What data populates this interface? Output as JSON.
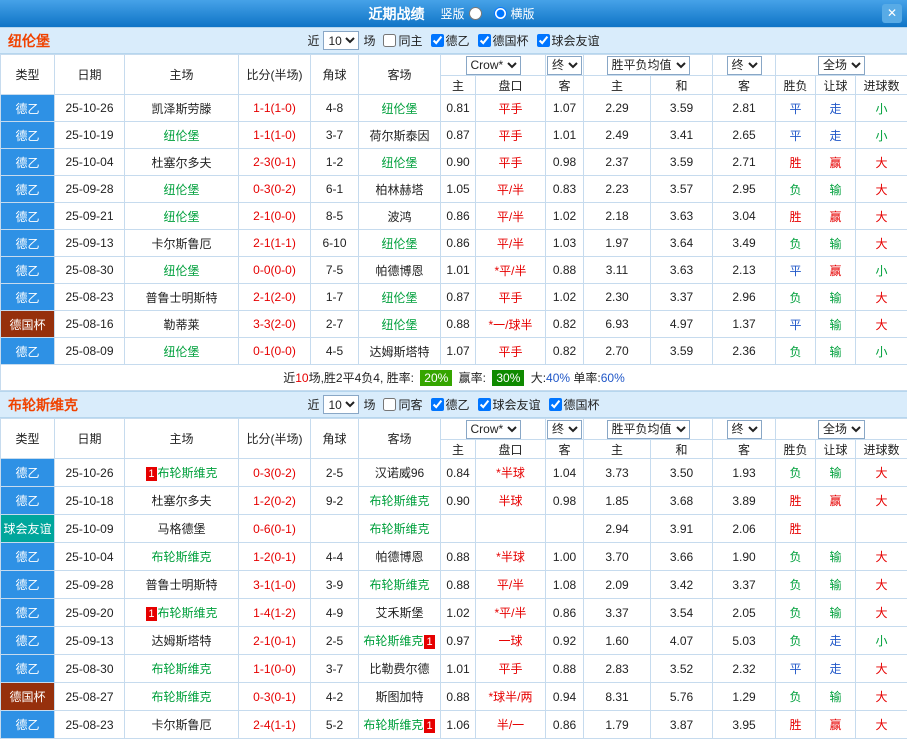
{
  "titlebar": {
    "title": "近期战绩",
    "layout_options": [
      {
        "label": "竖版",
        "selected": false
      },
      {
        "label": "横版",
        "selected": true
      }
    ],
    "close_label": "✕"
  },
  "table_header": {
    "type": "类型",
    "date": "日期",
    "home": "主场",
    "score": "比分(半场)",
    "corner": "角球",
    "away": "客场",
    "odds_company": "Crow*",
    "final1": "终",
    "avg_label": "胜平负均值",
    "final2": "终",
    "scope": "全场",
    "sub": [
      "主",
      "盘口",
      "客",
      "主",
      "和",
      "客",
      "胜负",
      "让球",
      "进球数"
    ]
  },
  "sections": [
    {
      "team": "纽伦堡",
      "filter": {
        "near": "近",
        "count": "10",
        "unit": "场",
        "checkboxes": [
          {
            "label": "同主",
            "checked": false
          },
          {
            "label": "德乙",
            "checked": true
          },
          {
            "label": "德国杯",
            "checked": true
          },
          {
            "label": "球会友谊",
            "checked": true
          }
        ]
      },
      "rows": [
        {
          "league": "德乙",
          "lc": "blue",
          "date": "25-10-26",
          "home": {
            "n": "凯泽斯劳滕",
            "f": false
          },
          "score": "1-1(1-0)",
          "corner": "4-8",
          "away": {
            "n": "纽伦堡",
            "f": true
          },
          "odds": [
            "0.81",
            "平手",
            "1.07"
          ],
          "avg": [
            "2.29",
            "3.59",
            "2.81"
          ],
          "results": [
            [
              "平",
              "b"
            ],
            [
              "走",
              "b"
            ],
            [
              "小",
              "g"
            ]
          ]
        },
        {
          "league": "德乙",
          "lc": "blue",
          "date": "25-10-19",
          "home": {
            "n": "纽伦堡",
            "f": true
          },
          "score": "1-1(1-0)",
          "corner": "3-7",
          "away": {
            "n": "荷尔斯泰因",
            "f": false
          },
          "odds": [
            "0.87",
            "平手",
            "1.01"
          ],
          "avg": [
            "2.49",
            "3.41",
            "2.65"
          ],
          "results": [
            [
              "平",
              "b"
            ],
            [
              "走",
              "b"
            ],
            [
              "小",
              "g"
            ]
          ]
        },
        {
          "league": "德乙",
          "lc": "blue",
          "date": "25-10-04",
          "home": {
            "n": "杜塞尔多夫",
            "f": false
          },
          "score": "2-3(0-1)",
          "corner": "1-2",
          "away": {
            "n": "纽伦堡",
            "f": true
          },
          "odds": [
            "0.90",
            "平手",
            "0.98"
          ],
          "avg": [
            "2.37",
            "3.59",
            "2.71"
          ],
          "results": [
            [
              "胜",
              "r"
            ],
            [
              "赢",
              "r"
            ],
            [
              "大",
              "r"
            ]
          ]
        },
        {
          "league": "德乙",
          "lc": "blue",
          "date": "25-09-28",
          "home": {
            "n": "纽伦堡",
            "f": true
          },
          "score": "0-3(0-2)",
          "corner": "6-1",
          "away": {
            "n": "柏林赫塔",
            "f": false
          },
          "odds": [
            "1.05",
            "平/半",
            "0.83"
          ],
          "avg": [
            "2.23",
            "3.57",
            "2.95"
          ],
          "results": [
            [
              "负",
              "g"
            ],
            [
              "输",
              "g"
            ],
            [
              "大",
              "r"
            ]
          ]
        },
        {
          "league": "德乙",
          "lc": "blue",
          "date": "25-09-21",
          "home": {
            "n": "纽伦堡",
            "f": true
          },
          "score": "2-1(0-0)",
          "corner": "8-5",
          "away": {
            "n": "波鸿",
            "f": false
          },
          "odds": [
            "0.86",
            "平/半",
            "1.02"
          ],
          "avg": [
            "2.18",
            "3.63",
            "3.04"
          ],
          "results": [
            [
              "胜",
              "r"
            ],
            [
              "赢",
              "r"
            ],
            [
              "大",
              "r"
            ]
          ]
        },
        {
          "league": "德乙",
          "lc": "blue",
          "date": "25-09-13",
          "home": {
            "n": "卡尔斯鲁厄",
            "f": false
          },
          "score": "2-1(1-1)",
          "corner": "6-10",
          "away": {
            "n": "纽伦堡",
            "f": true
          },
          "odds": [
            "0.86",
            "平/半",
            "1.03"
          ],
          "avg": [
            "1.97",
            "3.64",
            "3.49"
          ],
          "results": [
            [
              "负",
              "g"
            ],
            [
              "输",
              "g"
            ],
            [
              "大",
              "r"
            ]
          ]
        },
        {
          "league": "德乙",
          "lc": "blue",
          "date": "25-08-30",
          "home": {
            "n": "纽伦堡",
            "f": true
          },
          "score": "0-0(0-0)",
          "corner": "7-5",
          "away": {
            "n": "帕德博恩",
            "f": false
          },
          "odds": [
            "1.01",
            "*平/半",
            "0.88"
          ],
          "avg": [
            "3.11",
            "3.63",
            "2.13"
          ],
          "results": [
            [
              "平",
              "b"
            ],
            [
              "赢",
              "r"
            ],
            [
              "小",
              "g"
            ]
          ]
        },
        {
          "league": "德乙",
          "lc": "blue",
          "date": "25-08-23",
          "home": {
            "n": "普鲁士明斯特",
            "f": false
          },
          "score": "2-1(2-0)",
          "corner": "1-7",
          "away": {
            "n": "纽伦堡",
            "f": true
          },
          "odds": [
            "0.87",
            "平手",
            "1.02"
          ],
          "avg": [
            "2.30",
            "3.37",
            "2.96"
          ],
          "results": [
            [
              "负",
              "g"
            ],
            [
              "输",
              "g"
            ],
            [
              "大",
              "r"
            ]
          ]
        },
        {
          "league": "德国杯",
          "lc": "maroon",
          "date": "25-08-16",
          "home": {
            "n": "勒蒂莱",
            "f": false
          },
          "score": "3-3(2-0)",
          "corner": "2-7",
          "away": {
            "n": "纽伦堡",
            "f": true
          },
          "odds": [
            "0.88",
            "*一/球半",
            "0.82"
          ],
          "avg": [
            "6.93",
            "4.97",
            "1.37"
          ],
          "results": [
            [
              "平",
              "b"
            ],
            [
              "输",
              "g"
            ],
            [
              "大",
              "r"
            ]
          ]
        },
        {
          "league": "德乙",
          "lc": "blue",
          "date": "25-08-09",
          "home": {
            "n": "纽伦堡",
            "f": true
          },
          "score": "0-1(0-0)",
          "corner": "4-5",
          "away": {
            "n": "达姆斯塔特",
            "f": false
          },
          "odds": [
            "1.07",
            "平手",
            "0.82"
          ],
          "avg": [
            "2.70",
            "3.59",
            "2.36"
          ],
          "results": [
            [
              "负",
              "g"
            ],
            [
              "输",
              "g"
            ],
            [
              "小",
              "g"
            ]
          ]
        }
      ],
      "summary": [
        {
          "t": "近",
          "c": "k"
        },
        {
          "t": "10",
          "c": "r"
        },
        {
          "t": "场,胜2平4负4, 胜率: ",
          "c": "k"
        },
        {
          "t": "20%",
          "c": "g1"
        },
        {
          "t": " 赢率: ",
          "c": "k"
        },
        {
          "t": "30%",
          "c": "g2"
        },
        {
          "t": " 大:",
          "c": "k"
        },
        {
          "t": "40%",
          "c": "b"
        },
        {
          "t": " 单率:",
          "c": "k"
        },
        {
          "t": "60%",
          "c": "b"
        }
      ]
    },
    {
      "team": "布轮斯维克",
      "filter": {
        "near": "近",
        "count": "10",
        "unit": "场",
        "checkboxes": [
          {
            "label": "同客",
            "checked": false
          },
          {
            "label": "德乙",
            "checked": true
          },
          {
            "label": "球会友谊",
            "checked": true
          },
          {
            "label": "德国杯",
            "checked": true
          }
        ]
      },
      "rows": [
        {
          "league": "德乙",
          "lc": "blue",
          "date": "25-10-26",
          "home": {
            "n": "布轮斯维克",
            "f": true,
            "pre": true
          },
          "score": "0-3(0-2)",
          "corner": "2-5",
          "away": {
            "n": "汉诺威96",
            "f": false
          },
          "odds": [
            "0.84",
            "*半球",
            "1.04"
          ],
          "avg": [
            "3.73",
            "3.50",
            "1.93"
          ],
          "results": [
            [
              "负",
              "g"
            ],
            [
              "输",
              "g"
            ],
            [
              "大",
              "r"
            ]
          ]
        },
        {
          "league": "德乙",
          "lc": "blue",
          "date": "25-10-18",
          "home": {
            "n": "杜塞尔多夫",
            "f": false
          },
          "score": "1-2(0-2)",
          "corner": "9-2",
          "away": {
            "n": "布轮斯维克",
            "f": true
          },
          "odds": [
            "0.90",
            "半球",
            "0.98"
          ],
          "avg": [
            "1.85",
            "3.68",
            "3.89"
          ],
          "results": [
            [
              "胜",
              "r"
            ],
            [
              "赢",
              "r"
            ],
            [
              "大",
              "r"
            ]
          ]
        },
        {
          "league": "球会友谊",
          "lc": "teal",
          "date": "25-10-09",
          "home": {
            "n": "马格德堡",
            "f": false
          },
          "score": "0-6(0-1)",
          "corner": "",
          "away": {
            "n": "布轮斯维克",
            "f": true
          },
          "odds": [
            "",
            "",
            ""
          ],
          "avg": [
            "2.94",
            "3.91",
            "2.06"
          ],
          "results": [
            [
              "胜",
              "r"
            ],
            [
              "",
              ""
            ],
            [
              "",
              ""
            ]
          ]
        },
        {
          "league": "德乙",
          "lc": "blue",
          "date": "25-10-04",
          "home": {
            "n": "布轮斯维克",
            "f": true
          },
          "score": "1-2(0-1)",
          "corner": "4-4",
          "away": {
            "n": "帕德博恩",
            "f": false
          },
          "odds": [
            "0.88",
            "*半球",
            "1.00"
          ],
          "avg": [
            "3.70",
            "3.66",
            "1.90"
          ],
          "results": [
            [
              "负",
              "g"
            ],
            [
              "输",
              "g"
            ],
            [
              "大",
              "r"
            ]
          ]
        },
        {
          "league": "德乙",
          "lc": "blue",
          "date": "25-09-28",
          "home": {
            "n": "普鲁士明斯特",
            "f": false
          },
          "score": "3-1(1-0)",
          "corner": "3-9",
          "away": {
            "n": "布轮斯维克",
            "f": true
          },
          "odds": [
            "0.88",
            "平/半",
            "1.08"
          ],
          "avg": [
            "2.09",
            "3.42",
            "3.37"
          ],
          "results": [
            [
              "负",
              "g"
            ],
            [
              "输",
              "g"
            ],
            [
              "大",
              "r"
            ]
          ]
        },
        {
          "league": "德乙",
          "lc": "blue",
          "date": "25-09-20",
          "home": {
            "n": "布轮斯维克",
            "f": true,
            "pre": true
          },
          "score": "1-4(1-2)",
          "corner": "4-9",
          "away": {
            "n": "艾禾斯堡",
            "f": false
          },
          "odds": [
            "1.02",
            "*平/半",
            "0.86"
          ],
          "avg": [
            "3.37",
            "3.54",
            "2.05"
          ],
          "results": [
            [
              "负",
              "g"
            ],
            [
              "输",
              "g"
            ],
            [
              "大",
              "r"
            ]
          ]
        },
        {
          "league": "德乙",
          "lc": "blue",
          "date": "25-09-13",
          "home": {
            "n": "达姆斯塔特",
            "f": false
          },
          "score": "2-1(0-1)",
          "corner": "2-5",
          "away": {
            "n": "布轮斯维克",
            "f": true,
            "post": true
          },
          "odds": [
            "0.97",
            "一球",
            "0.92"
          ],
          "avg": [
            "1.60",
            "4.07",
            "5.03"
          ],
          "results": [
            [
              "负",
              "g"
            ],
            [
              "走",
              "b"
            ],
            [
              "小",
              "g"
            ]
          ]
        },
        {
          "league": "德乙",
          "lc": "blue",
          "date": "25-08-30",
          "home": {
            "n": "布轮斯维克",
            "f": true
          },
          "score": "1-1(0-0)",
          "corner": "3-7",
          "away": {
            "n": "比勒费尔德",
            "f": false
          },
          "odds": [
            "1.01",
            "平手",
            "0.88"
          ],
          "avg": [
            "2.83",
            "3.52",
            "2.32"
          ],
          "results": [
            [
              "平",
              "b"
            ],
            [
              "走",
              "b"
            ],
            [
              "大",
              "r"
            ]
          ]
        },
        {
          "league": "德国杯",
          "lc": "maroon",
          "date": "25-08-27",
          "home": {
            "n": "布轮斯维克",
            "f": true
          },
          "score": "0-3(0-1)",
          "corner": "4-2",
          "away": {
            "n": "斯图加特",
            "f": false
          },
          "odds": [
            "0.88",
            "*球半/两",
            "0.94"
          ],
          "avg": [
            "8.31",
            "5.76",
            "1.29"
          ],
          "results": [
            [
              "负",
              "g"
            ],
            [
              "输",
              "g"
            ],
            [
              "大",
              "r"
            ]
          ]
        },
        {
          "league": "德乙",
          "lc": "blue",
          "date": "25-08-23",
          "home": {
            "n": "卡尔斯鲁厄",
            "f": false
          },
          "score": "2-4(1-1)",
          "corner": "5-2",
          "away": {
            "n": "布轮斯维克",
            "f": true,
            "post": true
          },
          "odds": [
            "1.06",
            "半/一",
            "0.86"
          ],
          "avg": [
            "1.79",
            "3.87",
            "3.95"
          ],
          "results": [
            [
              "胜",
              "r"
            ],
            [
              "赢",
              "r"
            ],
            [
              "大",
              "r"
            ]
          ]
        }
      ]
    }
  ]
}
